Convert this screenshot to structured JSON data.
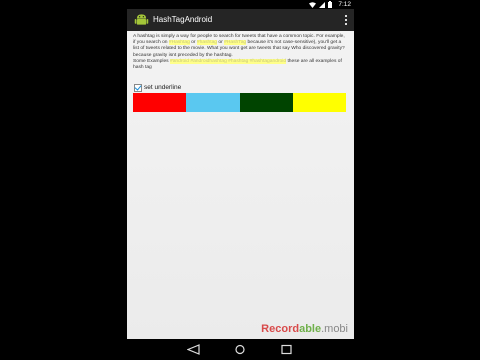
{
  "statusbar": {
    "time": "7:12"
  },
  "actionbar": {
    "title": "HashTagAndroid"
  },
  "content": {
    "description_parts": [
      {
        "text": "A hashtag is simply a way for people to search for tweets that have a common topic. For example, if you search on ",
        "highlight": false
      },
      {
        "text": "#Hashtag",
        "highlight": true
      },
      {
        "text": " or ",
        "highlight": false
      },
      {
        "text": "#hashtag",
        "highlight": true
      },
      {
        "text": " or ",
        "highlight": false
      },
      {
        "text": "#HashTag",
        "highlight": true
      },
      {
        "text": " because it's not case-sensitive), you'll get a list of tweets related to the movie. What you wont get are tweets that say Who discovered gravity? because gravity isnt preceded by the hashtag.",
        "highlight": false
      },
      {
        "text": "\nSome Examples ",
        "highlight": false
      },
      {
        "text": "#android #androidhashtag #hashtag #hashtagandroid",
        "highlight": true
      },
      {
        "text": " these are all examples of hash tag",
        "highlight": false
      }
    ],
    "checkbox": {
      "label": "set underline",
      "checked": true
    },
    "swatches": [
      "#ff0000",
      "#5ac8f0",
      "#004400",
      "#ffff00"
    ]
  },
  "watermark": {
    "part1": "Record",
    "part2": "able",
    "part3": ".mobi"
  }
}
